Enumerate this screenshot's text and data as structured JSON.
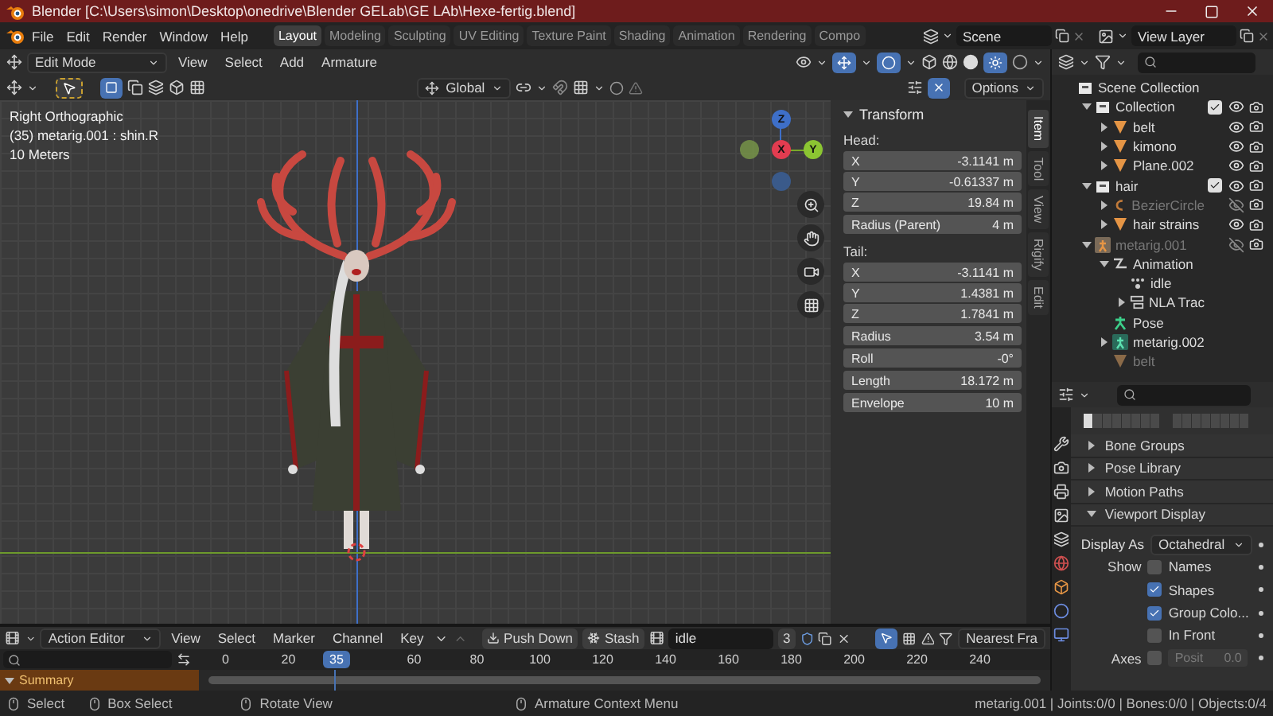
{
  "window": {
    "title": "Blender [C:\\Users\\simon\\Desktop\\onedrive\\Blender GELab\\GE LAb\\Hexe-fertig.blend]"
  },
  "menu": [
    "File",
    "Edit",
    "Render",
    "Window",
    "Help"
  ],
  "workspaces": [
    {
      "label": "Layout",
      "selected": true
    },
    {
      "label": "Modeling",
      "selected": false
    },
    {
      "label": "Sculpting",
      "selected": false
    },
    {
      "label": "UV Editing",
      "selected": false
    },
    {
      "label": "Texture Paint",
      "selected": false
    },
    {
      "label": "Shading",
      "selected": false
    },
    {
      "label": "Animation",
      "selected": false
    },
    {
      "label": "Rendering",
      "selected": false
    },
    {
      "label": "Compo",
      "selected": false
    }
  ],
  "scene": "Scene",
  "view_layer": "View Layer",
  "viewport_header": {
    "mode": "Edit Mode",
    "menus": [
      "View",
      "Select",
      "Add",
      "Armature"
    ],
    "orientation": "Global",
    "options": "Options"
  },
  "viewport": {
    "view": "Right Orthographic",
    "selection": "(35) metarig.001 : shin.R",
    "scale": "10 Meters",
    "gizmo": {
      "x": "X",
      "y": "Y",
      "z": "Z"
    }
  },
  "sidebar": {
    "tabs": [
      {
        "label": "Item",
        "selected": true
      },
      {
        "label": "Tool",
        "selected": false
      },
      {
        "label": "View",
        "selected": false
      },
      {
        "label": "Rigify",
        "selected": false
      },
      {
        "label": "Edit",
        "selected": false
      }
    ],
    "panel": "Transform",
    "head_label": "Head:",
    "head": [
      {
        "label": "X",
        "value": "-3.1141 m"
      },
      {
        "label": "Y",
        "value": "-0.61337 m"
      },
      {
        "label": "Z",
        "value": "19.84 m"
      }
    ],
    "head_radius": {
      "label": "Radius (Parent)",
      "value": "4 m"
    },
    "tail_label": "Tail:",
    "tail": [
      {
        "label": "X",
        "value": "-3.1141 m"
      },
      {
        "label": "Y",
        "value": "1.4381 m"
      },
      {
        "label": "Z",
        "value": "1.7841 m"
      }
    ],
    "fields": [
      {
        "label": "Radius",
        "value": "3.54 m"
      },
      {
        "label": "Roll",
        "value": "-0°"
      },
      {
        "label": "Length",
        "value": "18.172 m"
      },
      {
        "label": "Envelope",
        "value": "10 m"
      }
    ]
  },
  "outliner": {
    "items": [
      {
        "label": "Scene Collection",
        "kind": "scene_collection",
        "children": [
          {
            "label": "Collection",
            "kind": "collection",
            "expanded": true,
            "checked": true,
            "visible": true,
            "children": [
              {
                "label": "belt",
                "kind": "mesh",
                "expanded": false,
                "visible": true
              },
              {
                "label": "kimono",
                "kind": "mesh",
                "expanded": false,
                "visible": true
              },
              {
                "label": "Plane.002",
                "kind": "mesh",
                "expanded": false,
                "visible": true
              }
            ]
          },
          {
            "label": "hair",
            "kind": "collection",
            "expanded": true,
            "checked": true,
            "visible": true,
            "children": [
              {
                "label": "BezierCircle",
                "kind": "curve",
                "expanded": false,
                "visible": false
              },
              {
                "label": "hair strains",
                "kind": "mesh",
                "expanded": false,
                "visible": true
              }
            ]
          },
          {
            "label": "metarig.001",
            "kind": "armature",
            "expanded": true,
            "visible": false,
            "children": [
              {
                "label": "Animation",
                "kind": "animation",
                "expanded": true,
                "children": [
                  {
                    "label": "idle",
                    "kind": "action"
                  },
                  {
                    "label": "NLA Trac",
                    "kind": "nla",
                    "expanded": false
                  }
                ]
              },
              {
                "label": "Pose",
                "kind": "pose"
              },
              {
                "label": "metarig.002",
                "kind": "armature_data",
                "expanded": false
              },
              {
                "label": "belt",
                "kind": "mesh_dim"
              }
            ]
          }
        ]
      }
    ]
  },
  "properties": {
    "sections": [
      {
        "label": "Bone Groups",
        "expanded": false
      },
      {
        "label": "Pose Library",
        "expanded": false
      },
      {
        "label": "Motion Paths",
        "expanded": false
      },
      {
        "label": "Viewport Display",
        "expanded": true
      }
    ],
    "display_as": {
      "label": "Display As",
      "value": "Octahedral"
    },
    "show_label": "Show",
    "show": [
      {
        "label": "Names",
        "checked": false
      },
      {
        "label": "Shapes",
        "checked": true
      },
      {
        "label": "Group Colo...",
        "checked": true
      },
      {
        "label": "In Front",
        "checked": false
      }
    ],
    "axes": {
      "label": "Axes",
      "checked": false,
      "position": {
        "label": "Posit",
        "value": "0.0",
        "disabled": true
      }
    }
  },
  "action_editor": {
    "editor": "Action Editor",
    "menus": [
      "View",
      "Select",
      "Marker",
      "Channel",
      "Key"
    ],
    "push_down": "Push Down",
    "stash": "Stash",
    "action": "idle",
    "users": "3",
    "snapping": "Nearest Fra"
  },
  "timeline": {
    "frames_before": [
      "0",
      "20"
    ],
    "current": "35",
    "frames_after": [
      "60",
      "80",
      "100",
      "120",
      "140",
      "160",
      "180",
      "200",
      "220",
      "240"
    ],
    "channel": "Summary"
  },
  "status_bar": {
    "hints": [
      "Select",
      "Box Select",
      "Rotate View",
      "Armature Context Menu"
    ],
    "stats": "metarig.001 | Joints:0/0 | Bones:0/0 | Objects:0/4"
  }
}
